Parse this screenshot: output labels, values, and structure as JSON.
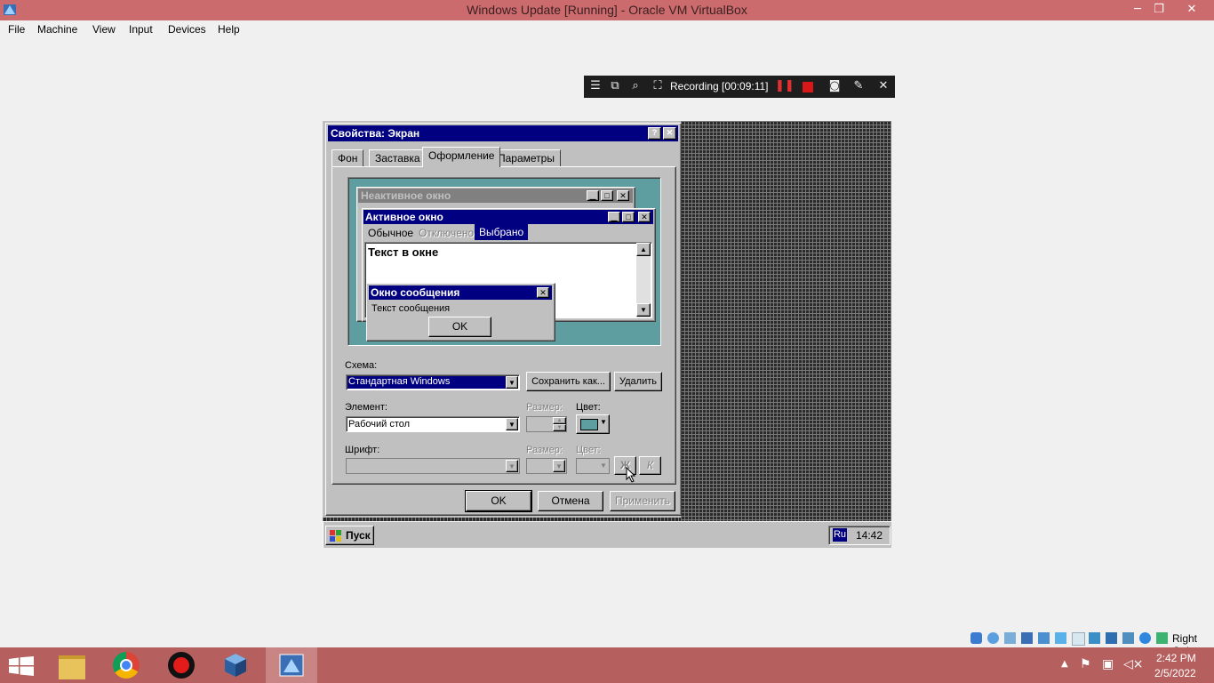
{
  "host": {
    "window_title": "Windows Update [Running] - Oracle VM VirtualBox",
    "menu": [
      "File",
      "Machine",
      "View",
      "Input",
      "Devices",
      "Help"
    ],
    "recording_label": "Recording [00:09:11]",
    "status_right": "Right Ctrl",
    "clock_time": "2:42 PM",
    "clock_date": "2/5/2022"
  },
  "dialog": {
    "title": "Свойства: Экран",
    "help_glyph": "?",
    "close_glyph": "✕",
    "tabs": [
      "Фон",
      "Заставка",
      "Оформление",
      "Параметры"
    ],
    "active_tab": "Оформление",
    "preview": {
      "inactive_title": "Неактивное окно",
      "active_title": "Активное окно",
      "menu_normal": "Обычное",
      "menu_disabled": "Отключено",
      "menu_selected": "Выбрано",
      "window_text": "Текст в окне",
      "msg_title": "Окно сообщения",
      "msg_text": "Текст сообщения",
      "msg_ok": "OK"
    },
    "scheme_label": "Схема:",
    "scheme_value": "Стандартная Windows",
    "save_as": "Сохранить как...",
    "delete": "Удалить",
    "element_label": "Элемент:",
    "element_value": "Рабочий стол",
    "size_label": "Размер:",
    "color_label": "Цвет:",
    "font_label": "Шрифт:",
    "font_size_label": "Размер:",
    "font_color_label": "Цвет:",
    "bold_glyph": "Ж",
    "italic_glyph": "К",
    "ok": "OK",
    "cancel": "Отмена",
    "apply": "Применить",
    "swatch_color": "#5f9ea0"
  },
  "guest_taskbar": {
    "start": "Пуск",
    "lang": "Ru",
    "time": "14:42"
  },
  "colors": {
    "host_titlebar": "#cc6b6d",
    "win95_title": "#000080",
    "win95_face": "#c0c0c0"
  }
}
